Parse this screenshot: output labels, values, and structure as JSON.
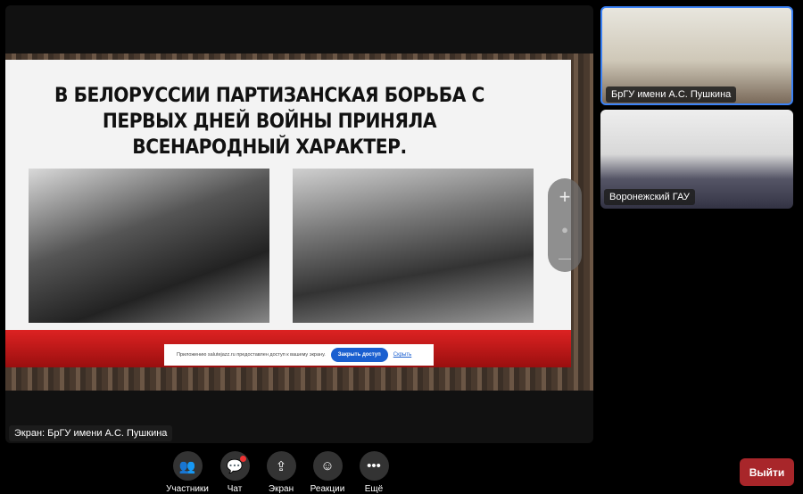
{
  "screen_share": {
    "slide_title": "В БЕЛОРУССИИ ПАРТИЗАНСКАЯ БОРЬБА С ПЕРВЫХ ДНЕЙ ВОЙНЫ ПРИНЯЛА ВСЕНАРОДНЫЙ ХАРАКТЕР.",
    "notice_text": "Приложению salutejazz.ru предоставлен доступ к вашему экрану.",
    "close_access_label": "Закрыть доступ",
    "hide_label": "Скрыть",
    "zoom_in": "+",
    "zoom_out": "—",
    "label": "Экран: БрГУ имени А.С. Пушкина"
  },
  "participants": [
    {
      "name": "БрГУ имени А.С. Пушкина"
    },
    {
      "name": "Воронежский ГАУ"
    }
  ],
  "toolbar": {
    "participants": "Участники",
    "chat": "Чат",
    "screen": "Экран",
    "reactions": "Реакции",
    "more": "Ещё",
    "exit": "Выйти"
  }
}
